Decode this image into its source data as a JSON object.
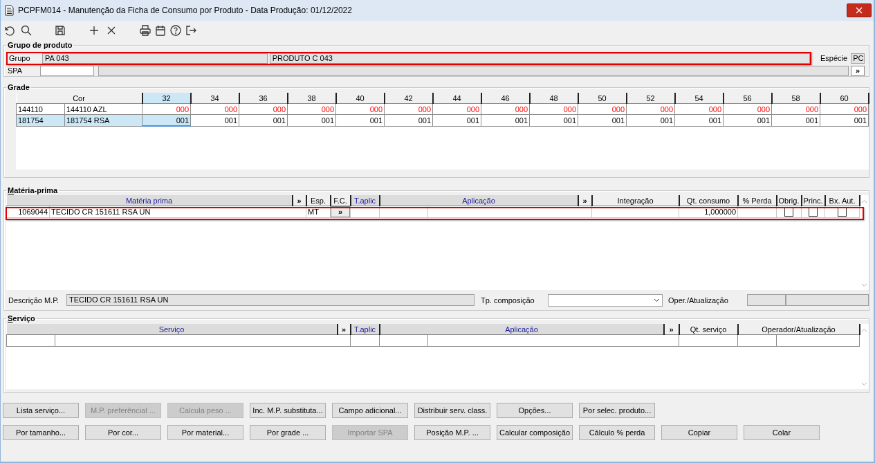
{
  "window": {
    "title": "PCPFM014 - Manutenção da Ficha de Consumo por Produto - Data Produção: 01/12/2022"
  },
  "grupo_de_produto": {
    "title": "Grupo de produto",
    "highlighted": true,
    "grupo_label": "Grupo",
    "grupo_code": "PA 043",
    "grupo_name": "PRODUTO C 043",
    "especie_label": "Espécie",
    "especie_value": "PC",
    "spa_label": "SPA",
    "spa_button": "»"
  },
  "grade": {
    "title": "Grade",
    "columns": [
      {
        "label": "Cor",
        "selected": false
      },
      {
        "label": "32",
        "selected": true
      },
      {
        "label": "34",
        "selected": false
      },
      {
        "label": "36",
        "selected": false
      },
      {
        "label": "38",
        "selected": false
      },
      {
        "label": "40",
        "selected": false
      },
      {
        "label": "42",
        "selected": false
      },
      {
        "label": "44",
        "selected": false
      },
      {
        "label": "46",
        "selected": false
      },
      {
        "label": "48",
        "selected": false
      },
      {
        "label": "50",
        "selected": false
      },
      {
        "label": "52",
        "selected": false
      },
      {
        "label": "54",
        "selected": false
      },
      {
        "label": "56",
        "selected": false
      },
      {
        "label": "58",
        "selected": false
      },
      {
        "label": "60",
        "selected": false
      }
    ],
    "rows": [
      {
        "code": "144110",
        "name": "144110 AZL",
        "selected": false,
        "kind": "zero",
        "values": [
          "000",
          "000",
          "000",
          "000",
          "000",
          "000",
          "000",
          "000",
          "000",
          "000",
          "000",
          "000",
          "000",
          "000",
          "000"
        ]
      },
      {
        "code": "181754",
        "name": "181754 RSA",
        "selected": true,
        "kind": "set",
        "values": [
          "001",
          "001",
          "001",
          "001",
          "001",
          "001",
          "001",
          "001",
          "001",
          "001",
          "001",
          "001",
          "001",
          "001",
          "001"
        ]
      }
    ]
  },
  "materia_prima": {
    "title": "Matéria-prima",
    "mnemonic": true,
    "columns": [
      {
        "label": "Matéria prima",
        "kind": "link"
      },
      {
        "label": "»",
        "kind": "expand"
      },
      {
        "label": "Esp.",
        "kind": "plain"
      },
      {
        "label": "F.C.",
        "kind": "plain"
      },
      {
        "label": "T.aplic",
        "kind": "link"
      },
      {
        "label": "Aplicação",
        "kind": "link"
      },
      {
        "label": "»",
        "kind": "expand"
      },
      {
        "label": "Integração",
        "kind": "plain"
      },
      {
        "label": "Qt. consumo",
        "kind": "plain"
      },
      {
        "label": "% Perda",
        "kind": "plain"
      },
      {
        "label": "Obrig.",
        "kind": "plain"
      },
      {
        "label": "Princ.",
        "kind": "plain"
      },
      {
        "label": "Bx. Aut.",
        "kind": "plain"
      }
    ],
    "rows": [
      {
        "highlighted": true,
        "code": "1069044",
        "name": "TECIDO CR 151611 RSA UN",
        "esp": "MT",
        "fc_button": "»",
        "qt_consumo": "1,000000",
        "obrig": false,
        "princ": false,
        "bx_aut": false
      }
    ],
    "descricao_label": "Descrição M.P.",
    "descricao_value": "TECIDO CR 151611 RSA UN",
    "tp_composicao_label": "Tp. composição",
    "oper_label": "Oper./Atualização"
  },
  "servico": {
    "title": "Serviço",
    "mnemonic": true,
    "columns": [
      {
        "label": "Serviço",
        "kind": "link"
      },
      {
        "label": "»",
        "kind": "expand"
      },
      {
        "label": "T.aplic",
        "kind": "link"
      },
      {
        "label": "Aplicação",
        "kind": "link"
      },
      {
        "label": "»",
        "kind": "expand"
      },
      {
        "label": "Qt. serviço",
        "kind": "plain"
      },
      {
        "label": "Operador/Atualização",
        "kind": "plain"
      }
    ]
  },
  "buttons": [
    [
      {
        "label": "Lista serviço...",
        "disabled": false
      },
      {
        "label": "M.P. preferêncial ...",
        "disabled": true
      },
      {
        "label": "Calcula peso ...",
        "disabled": true
      },
      {
        "label": "Inc. M.P. substituta...",
        "disabled": false
      },
      {
        "label": "Campo adicional...",
        "disabled": false
      },
      {
        "label": "Distribuir serv. class.",
        "disabled": false
      },
      {
        "label": "Opções...",
        "disabled": false
      },
      {
        "label": "Por selec. produto...",
        "disabled": false
      }
    ],
    [
      {
        "label": "Por tamanho...",
        "disabled": false
      },
      {
        "label": "Por cor...",
        "disabled": false
      },
      {
        "label": "Por material...",
        "disabled": false
      },
      {
        "label": "Por grade ...",
        "disabled": false
      },
      {
        "label": "Importar SPA",
        "disabled": true
      },
      {
        "label": "Posição M.P. ...",
        "disabled": false
      },
      {
        "label": "Calcular composição",
        "disabled": false
      },
      {
        "label": "Cálculo % perda",
        "disabled": false
      },
      {
        "label": "Copiar",
        "disabled": false
      },
      {
        "label": "Colar",
        "disabled": false
      }
    ]
  ]
}
